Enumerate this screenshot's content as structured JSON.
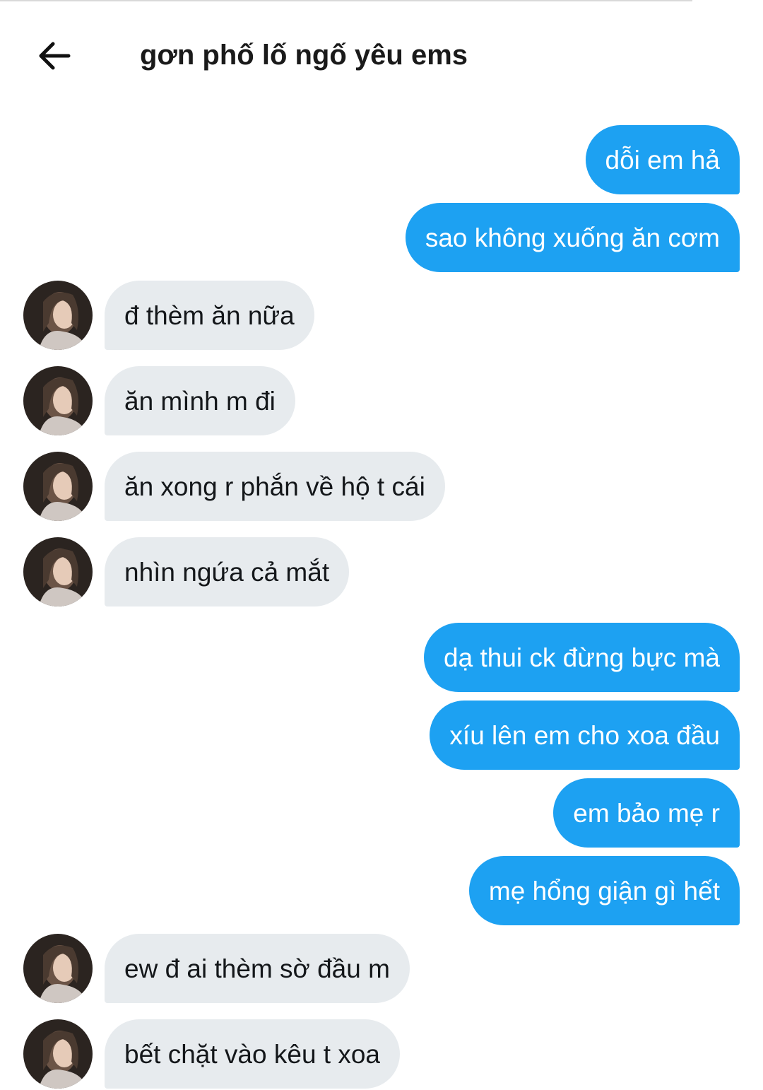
{
  "header": {
    "title": "gơn phố lố ngố yêu ems",
    "back_icon": "arrow-left-icon"
  },
  "colors": {
    "sent_bubble": "#1da1f2",
    "received_bubble": "#e7ebee",
    "sent_text": "#ffffff",
    "received_text": "#14171a"
  },
  "messages": [
    {
      "sender": "me",
      "text": "dỗi em hả"
    },
    {
      "sender": "me",
      "text": "sao không xuống ăn cơm"
    },
    {
      "sender": "them",
      "text": "đ thèm ăn nữa"
    },
    {
      "sender": "them",
      "text": "ăn mình m đi"
    },
    {
      "sender": "them",
      "text": "ăn xong r phắn về hộ t cái"
    },
    {
      "sender": "them",
      "text": "nhìn ngứa cả mắt"
    },
    {
      "sender": "me",
      "text": "dạ thui ck đừng bực mà"
    },
    {
      "sender": "me",
      "text": "xíu lên em cho xoa đầu"
    },
    {
      "sender": "me",
      "text": "em bảo mẹ r"
    },
    {
      "sender": "me",
      "text": "mẹ hổng giận gì hết"
    },
    {
      "sender": "them",
      "text": "ew đ ai thèm sờ đầu m"
    },
    {
      "sender": "them",
      "text": "bết chặt vào kêu t xoa"
    }
  ]
}
